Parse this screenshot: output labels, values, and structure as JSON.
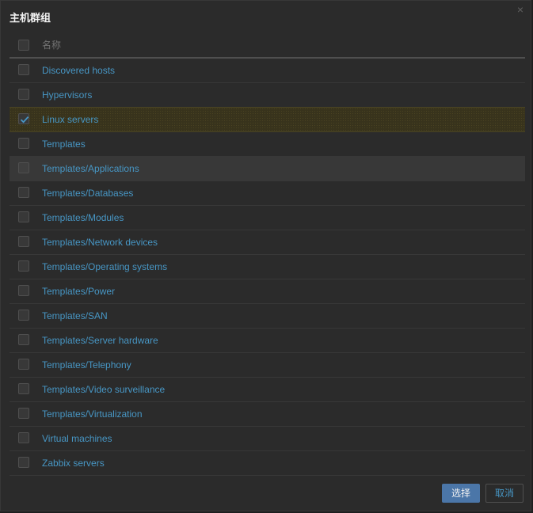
{
  "dialog": {
    "title": "主机群组",
    "close_icon": "×"
  },
  "table": {
    "header": {
      "name": "名称"
    },
    "rows": [
      {
        "name": "Discovered hosts",
        "checked": false
      },
      {
        "name": "Hypervisors",
        "checked": false
      },
      {
        "name": "Linux servers",
        "checked": true
      },
      {
        "name": "Templates",
        "checked": false
      },
      {
        "name": "Templates/Applications",
        "checked": false
      },
      {
        "name": "Templates/Databases",
        "checked": false
      },
      {
        "name": "Templates/Modules",
        "checked": false
      },
      {
        "name": "Templates/Network devices",
        "checked": false
      },
      {
        "name": "Templates/Operating systems",
        "checked": false
      },
      {
        "name": "Templates/Power",
        "checked": false
      },
      {
        "name": "Templates/SAN",
        "checked": false
      },
      {
        "name": "Templates/Server hardware",
        "checked": false
      },
      {
        "name": "Templates/Telephony",
        "checked": false
      },
      {
        "name": "Templates/Video surveillance",
        "checked": false
      },
      {
        "name": "Templates/Virtualization",
        "checked": false
      },
      {
        "name": "Virtual machines",
        "checked": false
      },
      {
        "name": "Zabbix servers",
        "checked": false
      }
    ]
  },
  "footer": {
    "select_label": "选择",
    "cancel_label": "取消"
  },
  "colors": {
    "background": "#2b2b2b",
    "link": "#4796c4",
    "selected_row": "#38331c",
    "hover_row": "#383838",
    "primary_button": "#4b76a8"
  }
}
